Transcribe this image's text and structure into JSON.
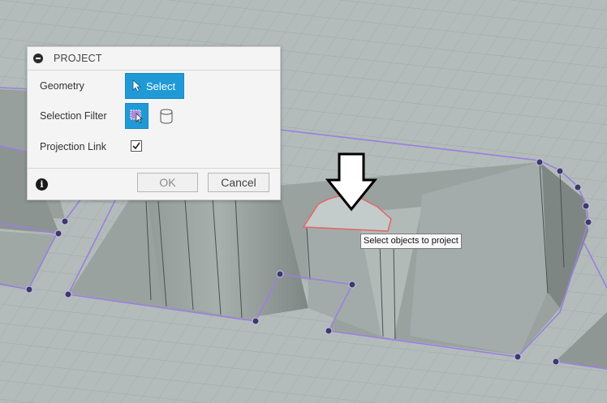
{
  "dialog": {
    "title": "PROJECT",
    "geometry_label": "Geometry",
    "select_label": "Select",
    "selection_filter_label": "Selection Filter",
    "projection_link_label": "Projection Link",
    "projection_link_checked": true,
    "ok_label": "OK",
    "cancel_label": "Cancel"
  },
  "tooltip": {
    "text": "Select objects to project"
  },
  "colors": {
    "accent": "#1f9ad6",
    "model_surface": "#a9b3b1",
    "edge_highlight": "#9a7fe0",
    "vertex": "#3d3a66",
    "selection_outline": "#e06a6a"
  }
}
